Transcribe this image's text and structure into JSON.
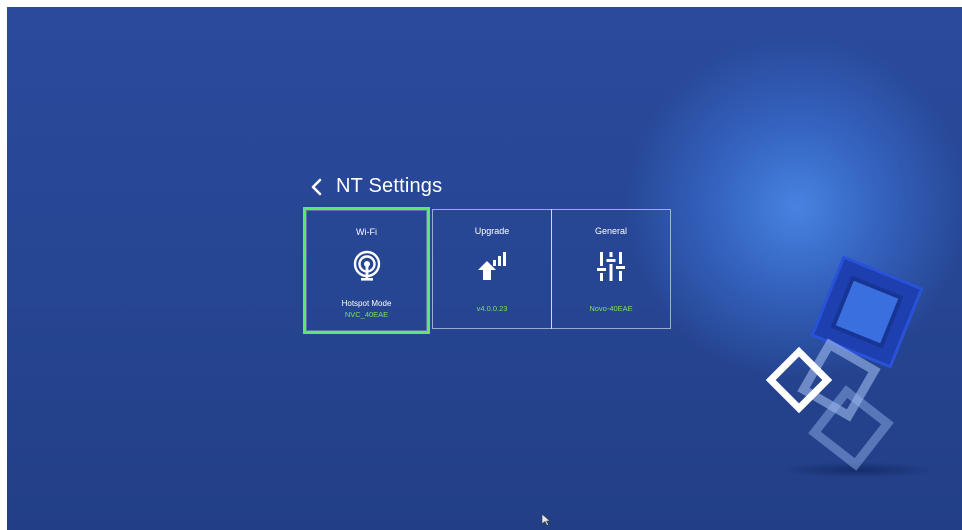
{
  "header": {
    "title": "NT Settings"
  },
  "tiles": [
    {
      "name": "Wi-Fi",
      "icon": "wifi-hotspot-icon",
      "subtitle": "Hotspot Mode",
      "status": "NVC_40EAE",
      "selected": true
    },
    {
      "name": "Upgrade",
      "icon": "upgrade-icon",
      "status": "v4.0.0.23",
      "selected": false
    },
    {
      "name": "General",
      "icon": "sliders-icon",
      "status": "Novo-40EAE",
      "selected": false
    }
  ],
  "colors": {
    "background": "#264592",
    "selection": "#5de86a",
    "status_text": "#7be060"
  }
}
